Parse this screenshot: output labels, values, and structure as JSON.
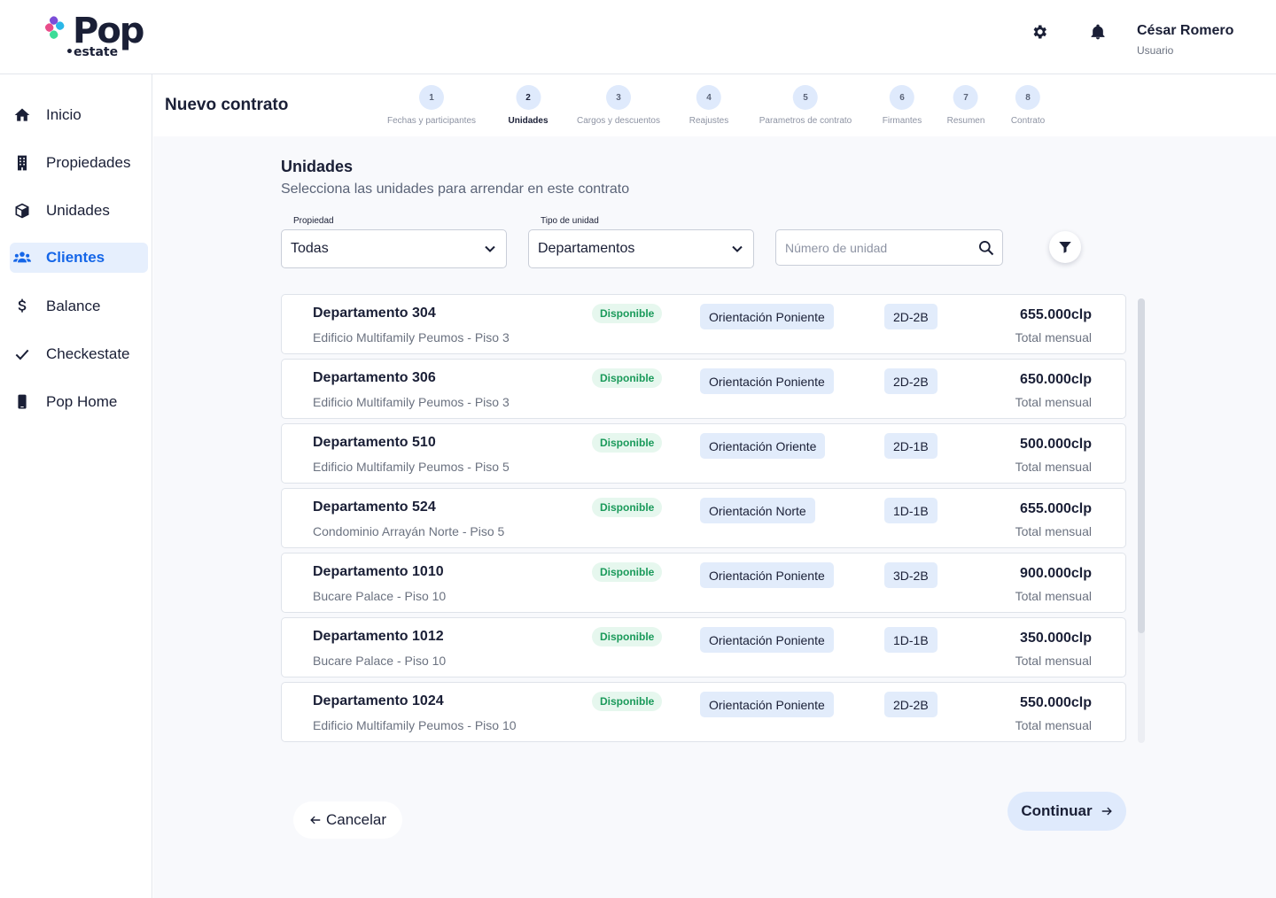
{
  "app": {
    "logo_text": "Pop",
    "logo_sub": "estate",
    "brand_colors": [
      "#7b4dd8",
      "#e84d8a",
      "#2ab7e8",
      "#3ddc97"
    ]
  },
  "header": {
    "settings_icon": "gear-icon",
    "notifications_icon": "bell-icon",
    "user_name": "César Romero",
    "user_role": "Usuario"
  },
  "sidebar": {
    "items": [
      {
        "label": "Inicio",
        "icon": "home-icon",
        "active": false
      },
      {
        "label": "Propiedades",
        "icon": "building-icon",
        "active": false
      },
      {
        "label": "Unidades",
        "icon": "box-icon",
        "active": false
      },
      {
        "label": "Clientes",
        "icon": "users-icon",
        "active": true
      },
      {
        "label": "Balance",
        "icon": "dollar-icon",
        "active": false
      },
      {
        "label": "Checkestate",
        "icon": "check-icon",
        "active": false
      },
      {
        "label": "Pop Home",
        "icon": "phone-icon",
        "active": false
      }
    ],
    "active_color": "#1566e8"
  },
  "page": {
    "title": "Nuevo contrato",
    "steps": [
      {
        "number": "1",
        "label": "Fechas y participantes",
        "active": false
      },
      {
        "number": "2",
        "label": "Unidades",
        "active": true
      },
      {
        "number": "3",
        "label": "Cargos y descuentos",
        "active": false
      },
      {
        "number": "4",
        "label": "Reajustes",
        "active": false
      },
      {
        "number": "5",
        "label": "Parametros de contrato",
        "active": false
      },
      {
        "number": "6",
        "label": "Firmantes",
        "active": false
      },
      {
        "number": "7",
        "label": "Resumen",
        "active": false
      },
      {
        "number": "8",
        "label": "Contrato",
        "active": false
      }
    ]
  },
  "section": {
    "title": "Unidades",
    "subtitle": "Selecciona las unidades para arrendar en este contrato"
  },
  "filters": {
    "propiedad_label": "Propiedad",
    "propiedad_value": "Todas",
    "tipo_label": "Tipo de unidad",
    "tipo_value": "Departamentos",
    "search_placeholder": "Número de unidad",
    "search_icon": "search-icon",
    "filter_icon": "filter-icon"
  },
  "units": [
    {
      "name": "Departamento 304",
      "building": "Edificio Multifamily Peumos - Piso 3",
      "status": "Disponible",
      "orientation": "Orientación Poniente",
      "type": "2D-2B",
      "price": "655.000clp",
      "price_label": "Total mensual"
    },
    {
      "name": "Departamento 306",
      "building": "Edificio Multifamily Peumos - Piso 3",
      "status": "Disponible",
      "orientation": "Orientación Poniente",
      "type": "2D-2B",
      "price": "650.000clp",
      "price_label": "Total mensual"
    },
    {
      "name": "Departamento 510",
      "building": "Edificio Multifamily Peumos - Piso 5",
      "status": "Disponible",
      "orientation": "Orientación Oriente",
      "type": "2D-1B",
      "price": "500.000clp",
      "price_label": "Total mensual"
    },
    {
      "name": "Departamento 524",
      "building": "Condominio Arrayán Norte - Piso 5",
      "status": "Disponible",
      "orientation": "Orientación Norte",
      "type": "1D-1B",
      "price": "655.000clp",
      "price_label": "Total mensual"
    },
    {
      "name": "Departamento 1010",
      "building": "Bucare Palace - Piso 10",
      "status": "Disponible",
      "orientation": "Orientación Poniente",
      "type": "3D-2B",
      "price": "900.000clp",
      "price_label": "Total mensual"
    },
    {
      "name": "Departamento 1012",
      "building": "Bucare Palace - Piso 10",
      "status": "Disponible",
      "orientation": "Orientación Poniente",
      "type": "1D-1B",
      "price": "350.000clp",
      "price_label": "Total mensual"
    },
    {
      "name": "Departamento 1024",
      "building": "Edificio Multifamily Peumos - Piso 10",
      "status": "Disponible",
      "orientation": "Orientación Poniente",
      "type": "2D-2B",
      "price": "550.000clp",
      "price_label": "Total mensual"
    }
  ],
  "actions": {
    "cancel_label": "Cancelar",
    "continue_label": "Continuar"
  },
  "colors": {
    "status_badge_bg": "#e6f7ee",
    "status_badge_text": "#1a9a5a",
    "chip_bg": "#e2ecfb",
    "primary_light": "#dfeafc"
  }
}
